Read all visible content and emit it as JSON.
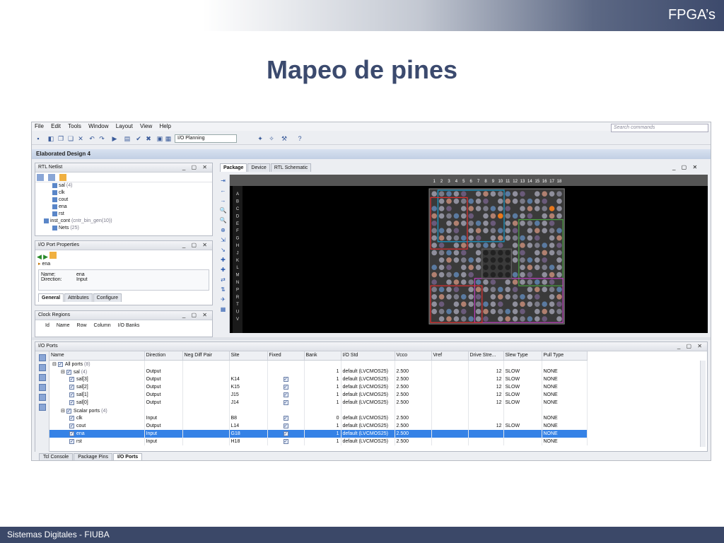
{
  "slide": {
    "brand": "FPGA’s",
    "title": "Mapeo de pines",
    "footer": "Sistemas Digitales - FIUBA"
  },
  "app": {
    "menu": [
      "File",
      "Edit",
      "Tools",
      "Window",
      "Layout",
      "View",
      "Help"
    ],
    "search_placeholder": "Search commands",
    "layout_select": "I/O Planning",
    "design_header": "Elaborated Design",
    "design_header_suffix": "4"
  },
  "rtl_netlist": {
    "title": "RTL Netlist",
    "items": [
      {
        "label": "sal",
        "extra": "(4)",
        "level": 1
      },
      {
        "label": "clk",
        "extra": "",
        "level": 1
      },
      {
        "label": "cout",
        "extra": "",
        "level": 1
      },
      {
        "label": "ena",
        "extra": "",
        "level": 1
      },
      {
        "label": "rst",
        "extra": "",
        "level": 1
      },
      {
        "label": "inst_cont",
        "extra": "(cntr_bin_gen(10))",
        "level": 0
      },
      {
        "label": "Nets",
        "extra": "(25)",
        "level": 1
      }
    ]
  },
  "io_port_props": {
    "title": "I/O Port Properties",
    "selected": "ena",
    "name_label": "Name:",
    "name_value": "ena",
    "direction_label": "Direction:",
    "direction_value": "Input",
    "tabs": [
      "General",
      "Attributes",
      "Configure"
    ]
  },
  "clock_regions": {
    "title": "Clock Regions",
    "columns": [
      "Id",
      "Name",
      "Row",
      "Column",
      "I/O Banks"
    ]
  },
  "center_tabs": [
    "Package",
    "Device",
    "RTL Schematic"
  ],
  "package": {
    "col_labels": [
      "1",
      "2",
      "3",
      "4",
      "5",
      "6",
      "7",
      "8",
      "9",
      "10",
      "11",
      "12",
      "13",
      "14",
      "15",
      "16",
      "17",
      "18"
    ],
    "row_labels": [
      "A",
      "B",
      "C",
      "D",
      "E",
      "F",
      "G",
      "H",
      "J",
      "K",
      "L",
      "M",
      "N",
      "P",
      "R",
      "T",
      "U",
      "V"
    ]
  },
  "io_ports": {
    "title": "I/O Ports",
    "columns": [
      "Name",
      "Direction",
      "Neg Diff Pair",
      "Site",
      "Fixed",
      "Bank",
      "I/O Std",
      "Vcco",
      "Vref",
      "Drive Stre...",
      "Slew Type",
      "Pull Type"
    ],
    "rows": [
      {
        "name": "All ports",
        "count": "(8)",
        "dir": "",
        "site": "",
        "fixed": false,
        "bank": "",
        "iostd": "",
        "vcco": "",
        "drive": "",
        "slew": "",
        "pull": "",
        "level": 0,
        "group": true
      },
      {
        "name": "sal",
        "count": "(4)",
        "dir": "Output",
        "site": "",
        "fixed": false,
        "bank": "1",
        "iostd": "default (LVCMOS25)",
        "vcco": "2.500",
        "drive": "12",
        "slew": "SLOW",
        "pull": "NONE",
        "level": 1,
        "group": true
      },
      {
        "name": "sal[3]",
        "count": "",
        "dir": "Output",
        "site": "K14",
        "fixed": true,
        "bank": "1",
        "iostd": "default (LVCMOS25)",
        "vcco": "2.500",
        "drive": "12",
        "slew": "SLOW",
        "pull": "NONE",
        "level": 2,
        "group": false
      },
      {
        "name": "sal[2]",
        "count": "",
        "dir": "Output",
        "site": "K15",
        "fixed": true,
        "bank": "1",
        "iostd": "default (LVCMOS25)",
        "vcco": "2.500",
        "drive": "12",
        "slew": "SLOW",
        "pull": "NONE",
        "level": 2,
        "group": false
      },
      {
        "name": "sal[1]",
        "count": "",
        "dir": "Output",
        "site": "J15",
        "fixed": true,
        "bank": "1",
        "iostd": "default (LVCMOS25)",
        "vcco": "2.500",
        "drive": "12",
        "slew": "SLOW",
        "pull": "NONE",
        "level": 2,
        "group": false
      },
      {
        "name": "sal[0]",
        "count": "",
        "dir": "Output",
        "site": "J14",
        "fixed": true,
        "bank": "1",
        "iostd": "default (LVCMOS25)",
        "vcco": "2.500",
        "drive": "12",
        "slew": "SLOW",
        "pull": "NONE",
        "level": 2,
        "group": false
      },
      {
        "name": "Scalar ports",
        "count": "(4)",
        "dir": "",
        "site": "",
        "fixed": false,
        "bank": "",
        "iostd": "",
        "vcco": "",
        "drive": "",
        "slew": "",
        "pull": "",
        "level": 1,
        "group": true
      },
      {
        "name": "clk",
        "count": "",
        "dir": "Input",
        "site": "B8",
        "fixed": true,
        "bank": "0",
        "iostd": "default (LVCMOS25)",
        "vcco": "2.500",
        "drive": "",
        "slew": "",
        "pull": "NONE",
        "level": 2,
        "group": false
      },
      {
        "name": "cout",
        "count": "",
        "dir": "Output",
        "site": "L14",
        "fixed": true,
        "bank": "1",
        "iostd": "default (LVCMOS25)",
        "vcco": "2.500",
        "drive": "12",
        "slew": "SLOW",
        "pull": "NONE",
        "level": 2,
        "group": false
      },
      {
        "name": "ena",
        "count": "",
        "dir": "Input",
        "site": "G18",
        "fixed": true,
        "bank": "1",
        "iostd": "default (LVCMOS25)",
        "vcco": "2.500",
        "drive": "",
        "slew": "",
        "pull": "NONE",
        "level": 2,
        "group": false,
        "selected": true
      },
      {
        "name": "rst",
        "count": "",
        "dir": "Input",
        "site": "H18",
        "fixed": true,
        "bank": "1",
        "iostd": "default (LVCMOS25)",
        "vcco": "2.500",
        "drive": "",
        "slew": "",
        "pull": "NONE",
        "level": 2,
        "group": false
      }
    ]
  },
  "bottom_tabs": [
    "Tcl Console",
    "Package Pins",
    "I/O Ports"
  ],
  "colors": {
    "selection": "#3582e6",
    "title": "#3b4a6e",
    "footer": "#3b4868"
  }
}
